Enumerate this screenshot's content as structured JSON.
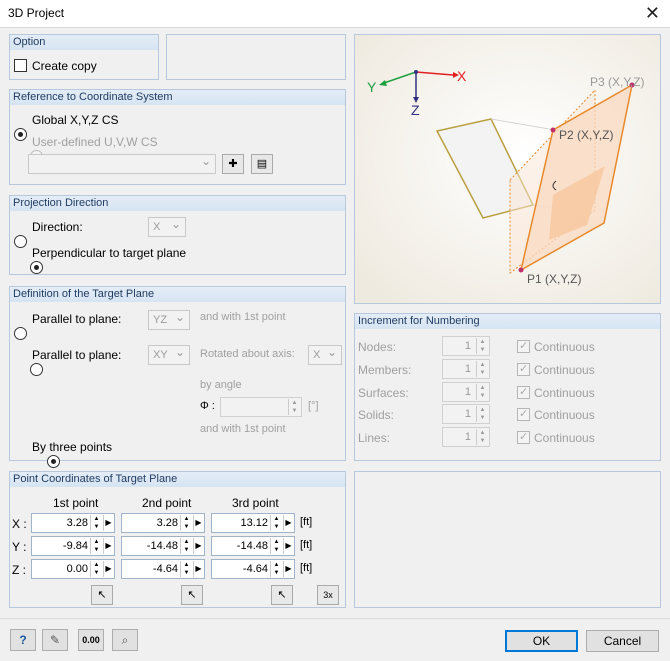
{
  "window": {
    "title": "3D Project",
    "close_glyph": "✕"
  },
  "option": {
    "header": "Option",
    "create_copy_label": "Create copy",
    "create_copy_checked": false
  },
  "reference": {
    "header": "Reference to Coordinate System",
    "global_label": "Global X,Y,Z CS",
    "user_label": "User-defined U,V,W CS",
    "selected": "global"
  },
  "projection": {
    "header": "Projection Direction",
    "direction_label": "Direction:",
    "direction_value": "X",
    "perpendicular_label": "Perpendicular to target plane",
    "selected": "perpendicular"
  },
  "target_plane": {
    "header": "Definition of the Target Plane",
    "parallel1_label": "Parallel to plane:",
    "parallel1_value": "YZ",
    "with_first_point_label": "and with 1st point",
    "parallel2_label": "Parallel to plane:",
    "parallel2_value": "XY",
    "rotated_label": "Rotated about axis:",
    "rotated_value": "X",
    "by_angle_label": "by angle",
    "phi_label": "Φ :",
    "angle_unit": "[°]",
    "with_first_point_label2": "and with 1st point",
    "three_points_label": "By three points",
    "selected": "three_points"
  },
  "points": {
    "header": "Point Coordinates of Target Plane",
    "col1": "1st point",
    "col2": "2nd point",
    "col3": "3rd point",
    "rows": [
      {
        "axis": "X :",
        "p1": "3.28",
        "p2": "3.28",
        "p3": "13.12",
        "unit": "[ft]"
      },
      {
        "axis": "Y :",
        "p1": "-9.84",
        "p2": "-14.48",
        "p3": "-14.48",
        "unit": "[ft]"
      },
      {
        "axis": "Z :",
        "p1": "0.00",
        "p2": "-4.64",
        "p3": "-4.64",
        "unit": "[ft]"
      }
    ],
    "pick3_label": "3x"
  },
  "increment": {
    "header": "Increment for Numbering",
    "continuous_label": "Continuous",
    "rows": [
      {
        "label": "Nodes:",
        "value": "1"
      },
      {
        "label": "Members:",
        "value": "1"
      },
      {
        "label": "Surfaces:",
        "value": "1"
      },
      {
        "label": "Solids:",
        "value": "1"
      },
      {
        "label": "Lines:",
        "value": "1"
      }
    ]
  },
  "diagram": {
    "axis_x": "X",
    "axis_y": "Y",
    "axis_z": "Z",
    "p1": "P1 (X,Y,Z)",
    "p2": "P2 (X,Y,Z)",
    "p3": "P3 (X,Y,Z)"
  },
  "footer": {
    "ok_label": "OK",
    "cancel_label": "Cancel",
    "units_label": "0.00"
  },
  "colors": {
    "accent": "#0078d7",
    "header_text": "#1e3a5f",
    "group_border": "#b7c8dc",
    "axis_x": "#e02020",
    "axis_y": "#20a040",
    "axis_z": "#303080",
    "plane": "#e8892a"
  }
}
